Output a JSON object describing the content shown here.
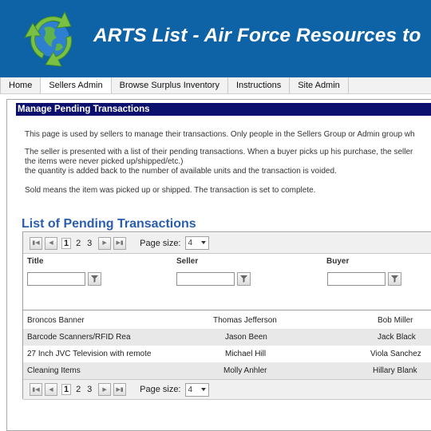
{
  "banner": {
    "title": "ARTS List - Air Force Resources to",
    "logo_icon": "recycle-globe-icon",
    "background": "#0e62a6"
  },
  "nav": {
    "items": [
      {
        "label": "Home"
      },
      {
        "label": "Sellers Admin",
        "active": true
      },
      {
        "label": "Browse Surplus Inventory"
      },
      {
        "label": "Instructions"
      },
      {
        "label": "Site Admin"
      }
    ]
  },
  "section": {
    "header": "Manage Pending Transactions",
    "para1": "This page is used by sellers to manage their transactions. Only people in the Sellers Group or Admin group wh",
    "para2_line1": "The seller is presented with a list of their pending transactions. When a buyer picks up his purchase, the seller",
    "para2_line2": "the items were never picked up/shipped/etc.)",
    "para2_line3": "the quantity is added back to the number of available units and the transaction is voided.",
    "para3": "Sold means the item was picked up or shipped. The transaction is set to complete."
  },
  "list": {
    "title": "List of Pending Transactions",
    "pager": {
      "first_icon": "first-page-icon",
      "prev_icon": "prev-page-icon",
      "next_icon": "next-page-icon",
      "last_icon": "last-page-icon",
      "pages": [
        "1",
        "2",
        "3"
      ],
      "current_page": "1",
      "page_size_label": "Page size:",
      "page_size": "4"
    },
    "columns": [
      "Title",
      "Seller",
      "Buyer"
    ],
    "rows": [
      {
        "title": "Broncos Banner",
        "seller": "Thomas Jefferson",
        "buyer": "Bob Miller"
      },
      {
        "title": "Barcode Scanners/RFID Rea",
        "seller": "Jason Been",
        "buyer": "Jack Black"
      },
      {
        "title": "27 Inch JVC Television with remote",
        "seller": "Michael Hill",
        "buyer": "Viola Sanchez"
      },
      {
        "title": "Cleaning Items",
        "seller": "Molly Anhler",
        "buyer": "Hillary Blank"
      }
    ]
  }
}
